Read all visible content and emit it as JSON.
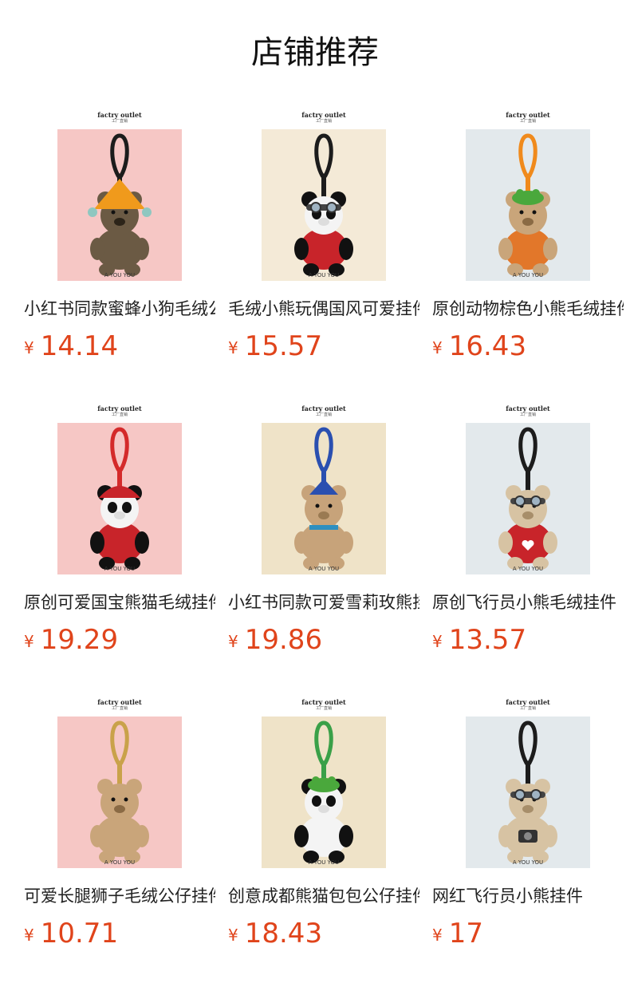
{
  "page": {
    "title": "店铺推荐"
  },
  "products": [
    {
      "name": "小红书同款蜜蜂小狗毛绒公仔挂件",
      "currency": "¥",
      "price": "14.14",
      "brand": "factry outlet",
      "brand_sub": "工厂直销",
      "watermark": "A YOU YOU",
      "image": {
        "subject": "dog-in-bee-hat-icon",
        "background": "#f6c7c5",
        "strap": "#1c1c1c"
      }
    },
    {
      "name": "毛绒小熊玩偶国风可爱挂件",
      "currency": "¥",
      "price": "15.57",
      "brand": "factry outlet",
      "brand_sub": "工厂直销",
      "watermark": "A YOU YOU",
      "image": {
        "subject": "panda-with-goggles-icon",
        "background": "#f4ead7",
        "strap": "#1c1c1c"
      }
    },
    {
      "name": "原创动物棕色小熊毛绒挂件",
      "currency": "¥",
      "price": "16.43",
      "brand": "factry outlet",
      "brand_sub": "工厂直销",
      "watermark": "A YOU YOU",
      "image": {
        "subject": "brown-bear-with-frog-hat-icon",
        "background": "#e3e9ec",
        "strap": "#f08a1c"
      }
    },
    {
      "name": "原创可爱国宝熊猫毛绒挂件",
      "currency": "¥",
      "price": "19.29",
      "brand": "factry outlet",
      "brand_sub": "工厂直销",
      "watermark": "A YOU YOU",
      "image": {
        "subject": "panda-in-red-sweater-icon",
        "background": "#f6c7c5",
        "strap": "#d42a2a"
      }
    },
    {
      "name": "小红书同款可爱雪莉玫熊挂件",
      "currency": "¥",
      "price": "19.86",
      "brand": "factry outlet",
      "brand_sub": "工厂直销",
      "watermark": "A YOU YOU",
      "image": {
        "subject": "teddy-bear-with-scarf-icon",
        "background": "#efe3c8",
        "strap": "#2a4fb0"
      }
    },
    {
      "name": "原创飞行员小熊毛绒挂件",
      "currency": "¥",
      "price": "13.57",
      "brand": "factry outlet",
      "brand_sub": "工厂直销",
      "watermark": "A YOU YOU",
      "image": {
        "subject": "pilot-bear-in-heart-sweater-icon",
        "background": "#e3e9ec",
        "strap": "#1c1c1c"
      }
    },
    {
      "name": "可爱长腿狮子毛绒公仔挂件",
      "currency": "¥",
      "price": "10.71",
      "brand": "factry outlet",
      "brand_sub": "工厂直销",
      "watermark": "A YOU YOU",
      "image": {
        "subject": "long-leg-lion-icon",
        "background": "#f6c7c5",
        "strap": "#c9a24a"
      }
    },
    {
      "name": "创意成都熊猫包包公仔挂件",
      "currency": "¥",
      "price": "18.43",
      "brand": "factry outlet",
      "brand_sub": "工厂直销",
      "watermark": "A YOU YOU",
      "image": {
        "subject": "panda-with-frog-hat-icon",
        "background": "#efe3c8",
        "strap": "#3aa048"
      }
    },
    {
      "name": "网红飞行员小熊挂件",
      "currency": "¥",
      "price": "17",
      "brand": "factry outlet",
      "brand_sub": "工厂直销",
      "watermark": "A YOU YOU",
      "image": {
        "subject": "pilot-bear-with-camera-icon",
        "background": "#e3e9ec",
        "strap": "#1c1c1c"
      }
    }
  ]
}
